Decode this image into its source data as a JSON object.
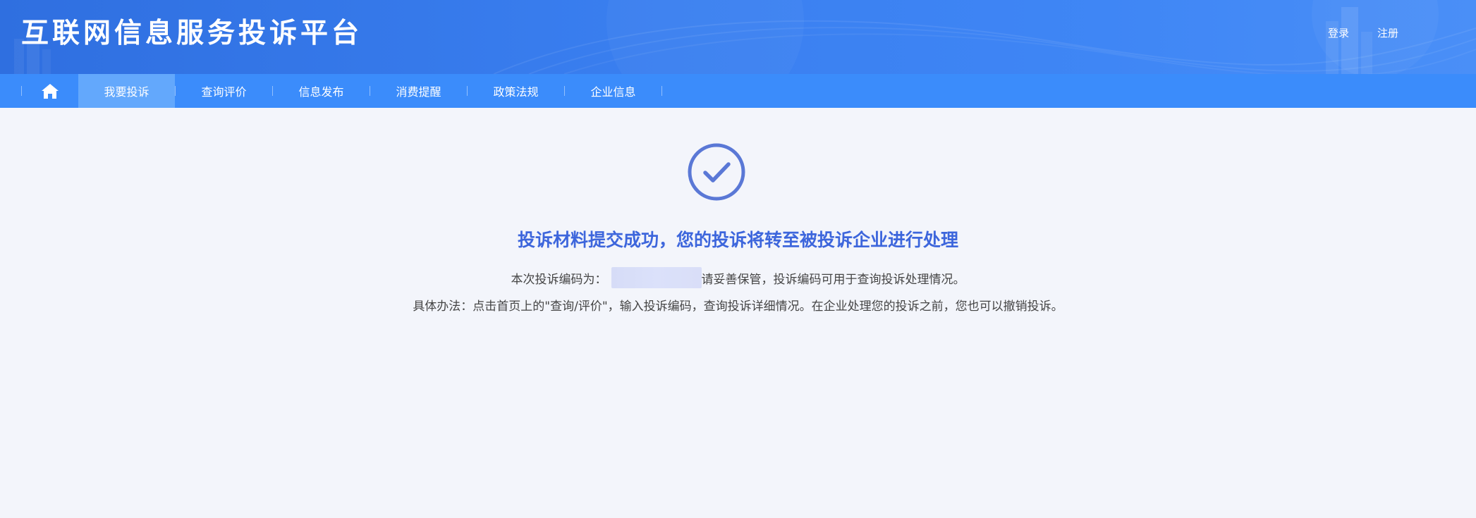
{
  "header": {
    "site_title": "互联网信息服务投诉平台",
    "login_label": "登录",
    "register_label": "注册"
  },
  "nav": {
    "home_icon": "home-icon",
    "items": [
      {
        "label": "我要投诉",
        "active": true
      },
      {
        "label": "查询评价",
        "active": false
      },
      {
        "label": "信息发布",
        "active": false
      },
      {
        "label": "消费提醒",
        "active": false
      },
      {
        "label": "政策法规",
        "active": false
      },
      {
        "label": "企业信息",
        "active": false
      }
    ]
  },
  "result": {
    "icon": "check-circle-icon",
    "title": "投诉材料提交成功，您的投诉将转至被投诉企业进行处理",
    "code_prefix": "本次投诉编码为：",
    "code_suffix": "请妥善保管，投诉编码可用于查询投诉处理情况。",
    "instructions": "具体办法：点击首页上的\"查询/评价\"，输入投诉编码，查询投诉详细情况。在企业处理您的投诉之前，您也可以撤销投诉。"
  },
  "colors": {
    "header_bg": "#3a7ff0",
    "nav_bg": "#3b8cfb",
    "nav_active_bg": "#63a8fc",
    "accent": "#3d66dc",
    "icon_stroke": "#5a78d6",
    "page_bg": "#f3f5fb"
  }
}
